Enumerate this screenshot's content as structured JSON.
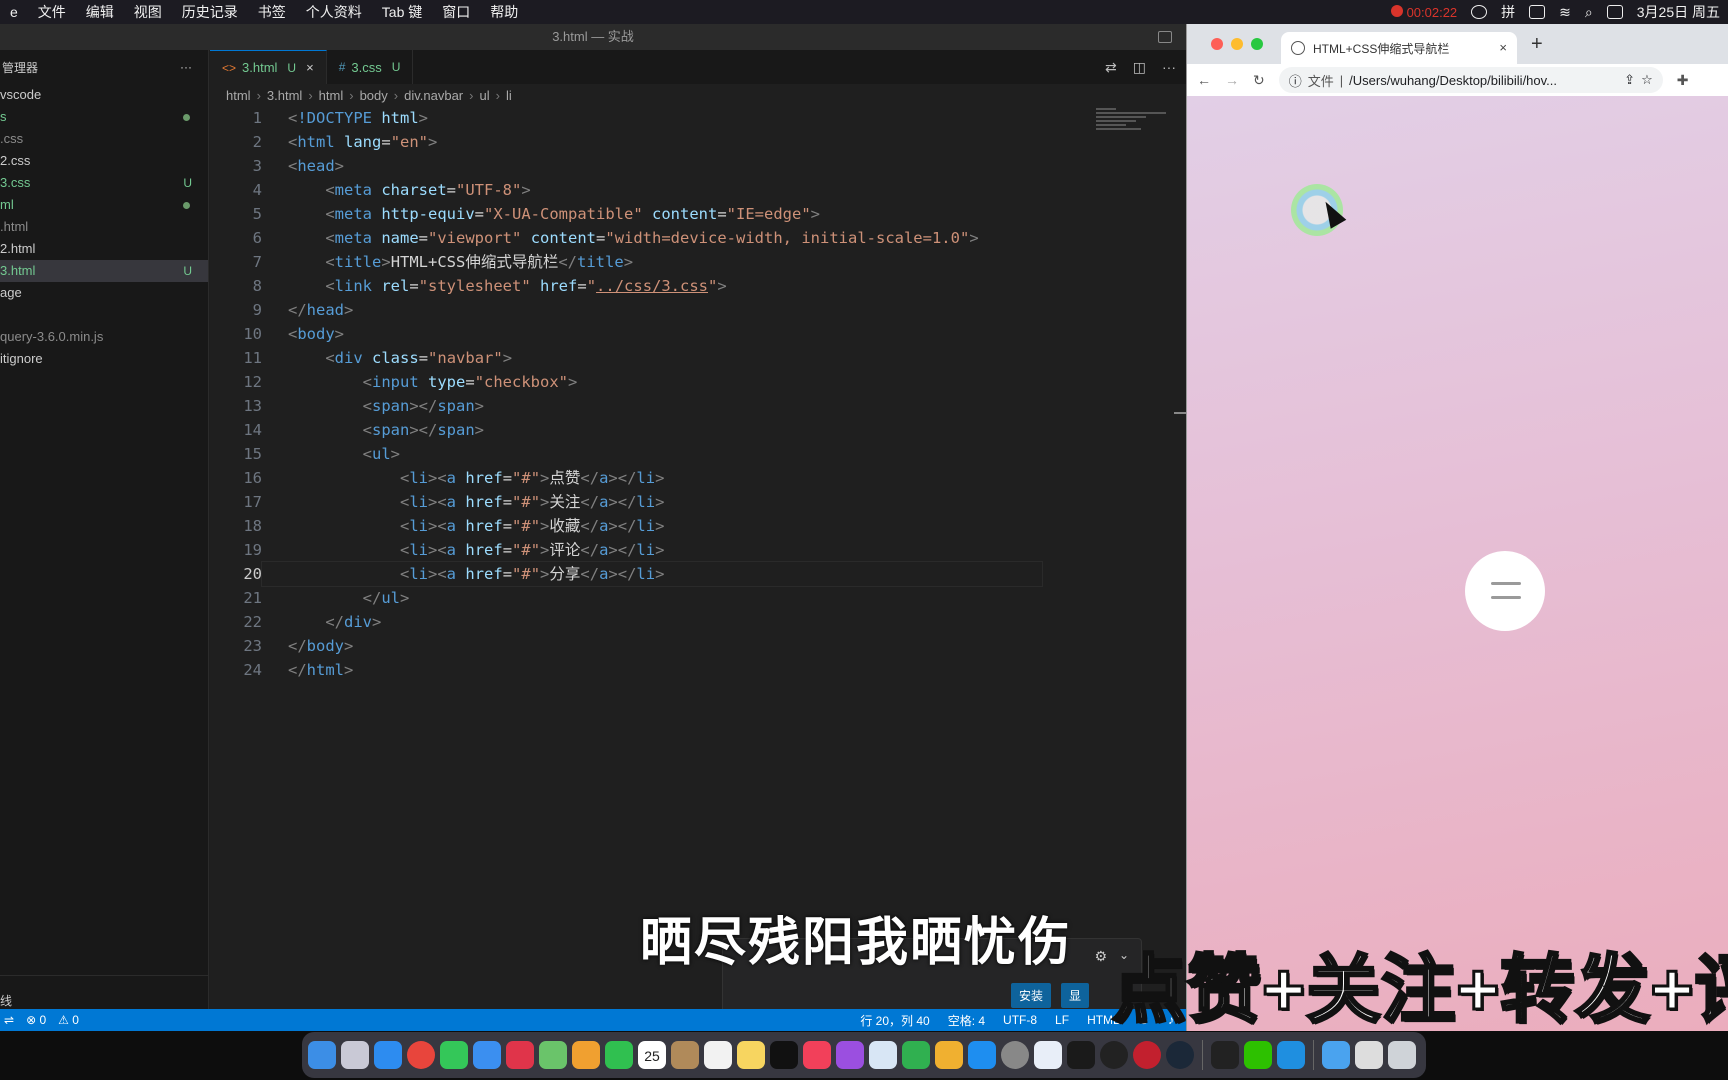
{
  "menubar": {
    "apple": "e",
    "items": [
      "文件",
      "编辑",
      "视图",
      "历史记录",
      "书签",
      "个人资料",
      "Tab 键",
      "窗口",
      "帮助"
    ],
    "rec_time": "00:02:22",
    "ime": "拼",
    "datetime": "3月25日 周五"
  },
  "vscode": {
    "title": "3.html — 实战",
    "sidebar": {
      "header": "管理器",
      "more": "···",
      "files": [
        {
          "name": "vscode",
          "color": "#cccccc",
          "badge": ""
        },
        {
          "name": "s",
          "color": "#73c991",
          "badge": "dot"
        },
        {
          "name": ".css",
          "color": "#8b8b8b",
          "badge": ""
        },
        {
          "name": "2.css",
          "color": "#cccccc",
          "badge": ""
        },
        {
          "name": "3.css",
          "color": "#73c991",
          "badge": "U"
        },
        {
          "name": "ml",
          "color": "#73c991",
          "badge": "dot"
        },
        {
          "name": ".html",
          "color": "#8b8b8b",
          "badge": ""
        },
        {
          "name": "2.html",
          "color": "#cccccc",
          "badge": ""
        },
        {
          "name": "3.html",
          "color": "#73c991",
          "badge": "U",
          "selected": true
        },
        {
          "name": "age",
          "color": "#cccccc",
          "badge": ""
        },
        {
          "name": "",
          "color": "#cccccc",
          "badge": ""
        },
        {
          "name": "query-3.6.0.min.js",
          "color": "#8b8b8b",
          "badge": ""
        },
        {
          "name": "itignore",
          "color": "#cccccc",
          "badge": ""
        }
      ],
      "outline": "线"
    },
    "tabs": [
      {
        "icon": "<>",
        "name": "3.html",
        "status": "U",
        "close": "×",
        "active": true
      },
      {
        "icon": "#",
        "name": "3.css",
        "status": "U",
        "close": "",
        "active": false
      }
    ],
    "breadcrumb": [
      "html",
      "3.html",
      "html",
      "body",
      "div.navbar",
      "ul",
      "li"
    ],
    "code": [
      {
        "n": "1",
        "html": "<span class='p'>&lt;</span><span class='t'>!DOCTYPE</span> <span class='a'>html</span><span class='p'>&gt;</span>"
      },
      {
        "n": "2",
        "html": "<span class='p'>&lt;</span><span class='t'>html</span> <span class='a'>lang</span><span class='txt'>=</span><span class='s'>\"en\"</span><span class='p'>&gt;</span>"
      },
      {
        "n": "3",
        "html": "<span class='p'>&lt;</span><span class='t'>head</span><span class='p'>&gt;</span>"
      },
      {
        "n": "4",
        "html": "    <span class='p'>&lt;</span><span class='t'>meta</span> <span class='a'>charset</span><span class='txt'>=</span><span class='s'>\"UTF-8\"</span><span class='p'>&gt;</span>"
      },
      {
        "n": "5",
        "html": "    <span class='p'>&lt;</span><span class='t'>meta</span> <span class='a'>http-equiv</span><span class='txt'>=</span><span class='s'>\"X-UA-Compatible\"</span> <span class='a'>content</span><span class='txt'>=</span><span class='s'>\"IE=edge\"</span><span class='p'>&gt;</span>"
      },
      {
        "n": "6",
        "html": "    <span class='p'>&lt;</span><span class='t'>meta</span> <span class='a'>name</span><span class='txt'>=</span><span class='s'>\"viewport\"</span> <span class='a'>content</span><span class='txt'>=</span><span class='s'>\"width=device-width, initial-scale=1.0\"</span><span class='p'>&gt;</span>"
      },
      {
        "n": "7",
        "html": "    <span class='p'>&lt;</span><span class='t'>title</span><span class='p'>&gt;</span><span class='txt'>HTML+CSS伸缩式导航栏</span><span class='p'>&lt;/</span><span class='t'>title</span><span class='p'>&gt;</span>"
      },
      {
        "n": "8",
        "html": "    <span class='p'>&lt;</span><span class='t'>link</span> <span class='a'>rel</span><span class='txt'>=</span><span class='s'>\"stylesheet\"</span> <span class='a'>href</span><span class='txt'>=</span><span class='s'>\"</span><span class='lnk'>../css/3.css</span><span class='s'>\"</span><span class='p'>&gt;</span>"
      },
      {
        "n": "9",
        "html": "<span class='p'>&lt;/</span><span class='t'>head</span><span class='p'>&gt;</span>"
      },
      {
        "n": "10",
        "html": "<span class='p'>&lt;</span><span class='t'>body</span><span class='p'>&gt;</span>"
      },
      {
        "n": "11",
        "html": "    <span class='p'>&lt;</span><span class='t'>div</span> <span class='a'>class</span><span class='txt'>=</span><span class='s'>\"navbar\"</span><span class='p'>&gt;</span>"
      },
      {
        "n": "12",
        "html": "        <span class='p'>&lt;</span><span class='t'>input</span> <span class='a'>type</span><span class='txt'>=</span><span class='s'>\"checkbox\"</span><span class='p'>&gt;</span>"
      },
      {
        "n": "13",
        "html": "        <span class='p'>&lt;</span><span class='t'>span</span><span class='p'>&gt;&lt;/</span><span class='t'>span</span><span class='p'>&gt;</span>"
      },
      {
        "n": "14",
        "html": "        <span class='p'>&lt;</span><span class='t'>span</span><span class='p'>&gt;&lt;/</span><span class='t'>span</span><span class='p'>&gt;</span>"
      },
      {
        "n": "15",
        "html": "        <span class='p'>&lt;</span><span class='t'>ul</span><span class='p'>&gt;</span>"
      },
      {
        "n": "16",
        "html": "            <span class='p'>&lt;</span><span class='t'>li</span><span class='p'>&gt;&lt;</span><span class='t'>a</span> <span class='a'>href</span><span class='txt'>=</span><span class='s'>\"#\"</span><span class='p'>&gt;</span><span class='txt'>点赞</span><span class='p'>&lt;/</span><span class='t'>a</span><span class='p'>&gt;&lt;/</span><span class='t'>li</span><span class='p'>&gt;</span>"
      },
      {
        "n": "17",
        "html": "            <span class='p'>&lt;</span><span class='t'>li</span><span class='p'>&gt;&lt;</span><span class='t'>a</span> <span class='a'>href</span><span class='txt'>=</span><span class='s'>\"#\"</span><span class='p'>&gt;</span><span class='txt'>关注</span><span class='p'>&lt;/</span><span class='t'>a</span><span class='p'>&gt;&lt;/</span><span class='t'>li</span><span class='p'>&gt;</span>"
      },
      {
        "n": "18",
        "html": "            <span class='p'>&lt;</span><span class='t'>li</span><span class='p'>&gt;&lt;</span><span class='t'>a</span> <span class='a'>href</span><span class='txt'>=</span><span class='s'>\"#\"</span><span class='p'>&gt;</span><span class='txt'>收藏</span><span class='p'>&lt;/</span><span class='t'>a</span><span class='p'>&gt;&lt;/</span><span class='t'>li</span><span class='p'>&gt;</span>"
      },
      {
        "n": "19",
        "html": "            <span class='p'>&lt;</span><span class='t'>li</span><span class='p'>&gt;&lt;</span><span class='t'>a</span> <span class='a'>href</span><span class='txt'>=</span><span class='s'>\"#\"</span><span class='p'>&gt;</span><span class='txt'>评论</span><span class='p'>&lt;/</span><span class='t'>a</span><span class='p'>&gt;&lt;/</span><span class='t'>li</span><span class='p'>&gt;</span>"
      },
      {
        "n": "20",
        "html": "            <span class='p'>&lt;</span><span class='t'>li</span><span class='p'>&gt;&lt;</span><span class='t'>a</span> <span class='a'>href</span><span class='txt'>=</span><span class='s'>\"#\"</span><span class='p'>&gt;</span><span class='txt'>分享</span><span class='p'>&lt;/</span><span class='t'>a</span><span class='p'>&gt;&lt;/</span><span class='t'>li</span><span class='p'>&gt;</span>",
        "current": true
      },
      {
        "n": "21",
        "html": "        <span class='p'>&lt;/</span><span class='t'>ul</span><span class='p'>&gt;</span>"
      },
      {
        "n": "22",
        "html": "    <span class='p'>&lt;/</span><span class='t'>div</span><span class='p'>&gt;</span>"
      },
      {
        "n": "23",
        "html": "<span class='p'>&lt;/</span><span class='t'>body</span><span class='p'>&gt;</span>"
      },
      {
        "n": "24",
        "html": "<span class='p'>&lt;/</span><span class='t'>html</span><span class='p'>&gt;</span>"
      }
    ],
    "notification": {
      "install": "安装",
      "show": "显"
    },
    "status": {
      "errors": "⊗ 0",
      "warnings": "⚠ 0",
      "position": "行 20，列 40",
      "spaces": "空格: 4",
      "encoding": "UTF-8",
      "eol": "LF",
      "language": "HTML"
    }
  },
  "chrome": {
    "tab_title": "HTML+CSS伸缩式导航栏",
    "tab_close": "×",
    "new_tab": "+",
    "addr_label": "文件",
    "url": "/Users/wuhang/Desktop/bilibili/hov..."
  },
  "captions": {
    "lyric": "晒尽残阳我晒忧伤",
    "banner": "点赞+关注+转发+评"
  },
  "dock": {
    "calendar_day": "25"
  },
  "colors": {
    "accent": "#0078d4",
    "status_bar": "#0078d4",
    "page_bg": "#e6bfd6"
  }
}
